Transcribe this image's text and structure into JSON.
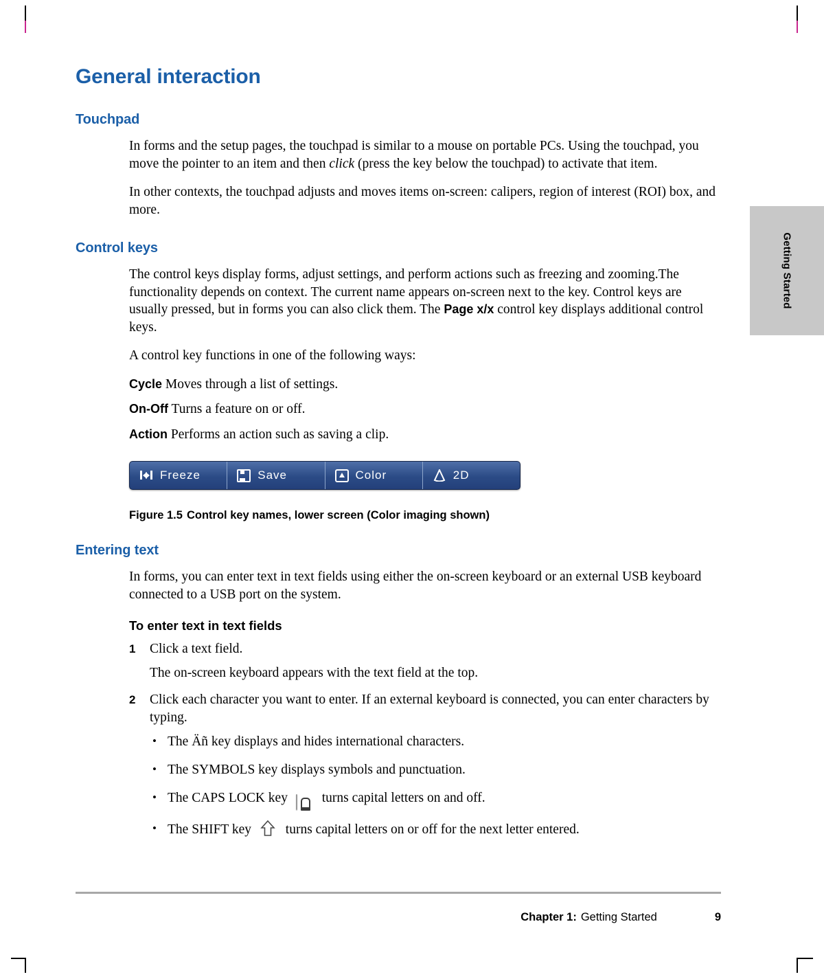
{
  "document": {
    "title": "General interaction",
    "sections": [
      {
        "heading": "Touchpad",
        "paragraphs": [
          "In forms and the setup pages, the touchpad is similar to a mouse on portable PCs. Using the touchpad, you move the pointer to an item and then click (press the key below the touchpad) to activate that item.",
          "In other contexts, the touchpad adjusts and moves items on-screen: calipers, region of interest (ROI) box, and more."
        ]
      },
      {
        "heading": "Control keys"
      },
      {
        "heading": "Entering text"
      }
    ]
  },
  "touchpad": {
    "para1_a": "In forms and the setup pages, the touchpad is similar to a mouse on portable PCs. Using the touchpad, you move the pointer to an item and then ",
    "para1_italic": "click",
    "para1_b": " (press the key below the touchpad) to activate that item.",
    "para2": "In other contexts, the touchpad adjusts and moves items on-screen: calipers, region of interest (ROI) box, and more."
  },
  "control_keys": {
    "para1_a": "The control keys display forms, adjust settings, and perform actions such as freezing and zooming.The functionality depends on context. The current name appears on-screen next to the key. Control keys are usually pressed, but in forms you can also click them. The ",
    "para1_bold": "Page x/x",
    "para1_b": " control key displays additional control keys.",
    "para2": "A control key functions in one of the following ways:",
    "modes": [
      {
        "term": "Cycle",
        "desc": " Moves through a list of settings."
      },
      {
        "term": "On-Off",
        "desc": " Turns a feature on or off."
      },
      {
        "term": "Action",
        "desc": " Performs an action such as saving a clip."
      }
    ],
    "keybar": [
      {
        "icon": "freeze-icon",
        "label": "Freeze"
      },
      {
        "icon": "save-icon",
        "label": "Save"
      },
      {
        "icon": "color-icon",
        "label": "Color"
      },
      {
        "icon": "2d-icon",
        "label": "2D"
      }
    ],
    "figure_caption_number": "Figure 1.5",
    "figure_caption_text": "Control key names, lower screen (Color imaging shown)"
  },
  "entering_text": {
    "para1": "In forms, you can enter text in text fields using either the on-screen keyboard or an external USB keyboard connected to a USB port on the system.",
    "procedure_title": "To enter text in text fields",
    "steps": [
      {
        "num": "1",
        "text": "Click a text field."
      },
      {
        "num": "2",
        "text": "Click each character you want to enter. If an external keyboard is connected, you can enter characters by typing."
      }
    ],
    "step1_result": "The on-screen keyboard appears with the text field at the top.",
    "bullets": [
      {
        "before": "The Äñ key displays and hides international characters.",
        "icon": null,
        "after": ""
      },
      {
        "before": "The SYMBOLS key displays symbols and punctuation.",
        "icon": null,
        "after": ""
      },
      {
        "before": "The CAPS LOCK key",
        "icon": "caps-lock-key-icon",
        "after": "turns capital letters on and off."
      },
      {
        "before": "The SHIFT key",
        "icon": "shift-key-icon",
        "after": "turns capital letters on or off for the next letter entered."
      }
    ]
  },
  "side_tab": {
    "label": "Getting Started"
  },
  "footer": {
    "chapter_label": "Chapter 1:",
    "chapter_name": "Getting Started",
    "page_number": "9"
  },
  "colors": {
    "heading_blue": "#1b5fa8",
    "side_tab_gray": "#c8c8c8",
    "keybar_blue": "#2b4b86",
    "crop_magenta": "#c9268f"
  }
}
